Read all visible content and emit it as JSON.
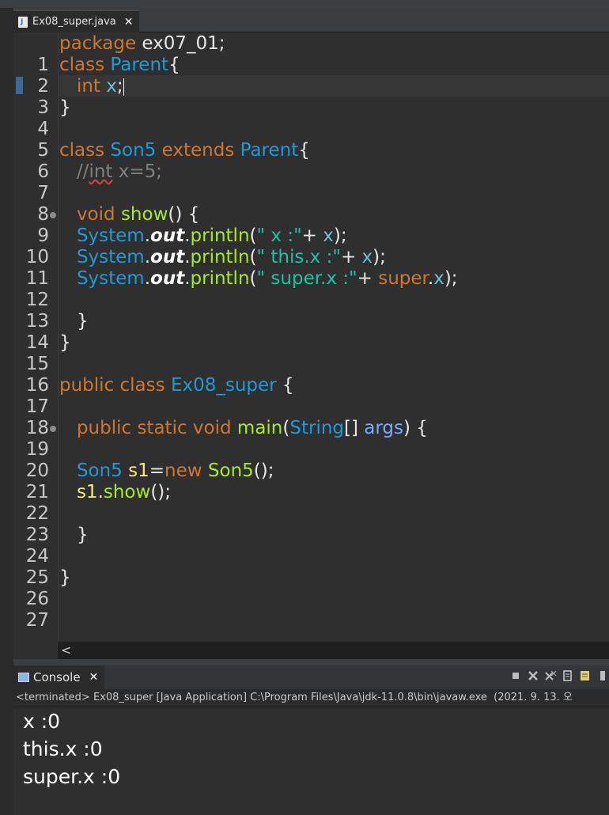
{
  "editor_tab": {
    "title": "Ex08_super.java",
    "close": "✕"
  },
  "editor": {
    "scroll_arrow": "<",
    "lines": [
      {
        "n": "1"
      },
      {
        "n": "2"
      },
      {
        "n": "3"
      },
      {
        "n": "4"
      },
      {
        "n": "5"
      },
      {
        "n": "6"
      },
      {
        "n": "7"
      },
      {
        "n": "8"
      },
      {
        "n": "9"
      },
      {
        "n": "10"
      },
      {
        "n": "11"
      },
      {
        "n": "12"
      },
      {
        "n": "13"
      },
      {
        "n": "14"
      },
      {
        "n": "15"
      },
      {
        "n": "16"
      },
      {
        "n": "17"
      },
      {
        "n": "18"
      },
      {
        "n": "19"
      },
      {
        "n": "20"
      },
      {
        "n": "21"
      },
      {
        "n": "22"
      },
      {
        "n": "23"
      },
      {
        "n": "24"
      },
      {
        "n": "25"
      },
      {
        "n": "26"
      },
      {
        "n": "27"
      }
    ],
    "code": {
      "l1": [
        "package",
        " ex07_01;"
      ],
      "l2": [
        "class",
        " ",
        "Parent",
        "{"
      ],
      "l3": [
        "int",
        " ",
        "x",
        ";"
      ],
      "l4": [
        "}"
      ],
      "l6": [
        "class",
        " ",
        "Son5",
        " ",
        "extends",
        " ",
        "Parent",
        "{"
      ],
      "l7": [
        "//",
        "int",
        " x=5;"
      ],
      "l9": [
        "void",
        " ",
        "show",
        "() {"
      ],
      "l10": [
        "System",
        ".",
        "out",
        ".",
        "println",
        "(",
        "\" x :\"",
        "+ ",
        "x",
        ");"
      ],
      "l11": [
        "System",
        ".",
        "out",
        ".",
        "println",
        "(",
        "\" this.x :\"",
        "+ ",
        "x",
        ");"
      ],
      "l12": [
        "System",
        ".",
        "out",
        ".",
        "println",
        "(",
        "\" super.x :\"",
        "+ ",
        "super",
        ".",
        "x",
        ");"
      ],
      "l14": [
        "}"
      ],
      "l15": [
        "}"
      ],
      "l17": [
        "public",
        " ",
        "class",
        " ",
        "Ex08_super",
        " {"
      ],
      "l19": [
        "public",
        " ",
        "static",
        " ",
        "void",
        " ",
        "main",
        "(",
        "String",
        "[] ",
        "args",
        ") {"
      ],
      "l21": [
        "Son5",
        " ",
        "s1",
        "=",
        "new",
        " ",
        "Son5",
        "();"
      ],
      "l22": [
        "s1",
        ".",
        "show",
        "();"
      ],
      "l24": [
        "}"
      ],
      "l26": [
        "}"
      ]
    }
  },
  "console": {
    "tab_title": "Console",
    "close": "✕",
    "status": "<terminated> Ex08_super [Java Application] C:\\Program Files\\Java\\jdk-11.0.8\\bin\\javaw.exe  (2021. 9. 13. 오",
    "output": [
      "x :0",
      "this.x :0",
      "super.x :0"
    ],
    "toolbar_icons": [
      "stop-icon",
      "remove-launch-icon",
      "remove-all-icon",
      "pin-icon",
      "display-console-icon",
      "more-icon"
    ]
  },
  "colors": {
    "keyword": "#cc7832",
    "class": "#1d9bd7",
    "field": "#66c2d4",
    "string": "#17c6a3",
    "method": "#a7ec21",
    "comment": "#808080",
    "local_var": "#f3ec79",
    "background": "#2f2f2f"
  }
}
